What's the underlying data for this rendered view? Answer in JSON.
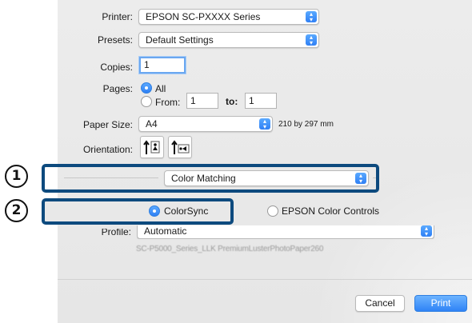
{
  "printer": {
    "label": "Printer:",
    "value": "EPSON SC-PXXXX Series"
  },
  "presets": {
    "label": "Presets:",
    "value": "Default Settings"
  },
  "copies": {
    "label": "Copies:",
    "value": "1"
  },
  "pages": {
    "label": "Pages:",
    "all_label": "All",
    "from_label": "From:",
    "from_value": "1",
    "to_label": "to:",
    "to_value": "1",
    "selected": "All"
  },
  "paper_size": {
    "label": "Paper Size:",
    "value": "A4",
    "dimensions": "210 by 297 mm"
  },
  "orientation": {
    "label": "Orientation:"
  },
  "panel_popup": {
    "value": "Color Matching"
  },
  "color_mode": {
    "colorsync_label": "ColorSync",
    "epson_label": "EPSON Color Controls",
    "selected": "ColorSync"
  },
  "profile": {
    "label": "Profile:",
    "value": "Automatic",
    "detail": "SC-P5000_Series_LLK PremiumLusterPhotoPaper260"
  },
  "buttons": {
    "cancel": "Cancel",
    "print": "Print"
  },
  "callouts": {
    "one": "1",
    "two": "2"
  },
  "colors": {
    "accent": "#2f83f6",
    "callout_border": "#0d4a7e",
    "dialog_bg": "#e8e8e8"
  }
}
